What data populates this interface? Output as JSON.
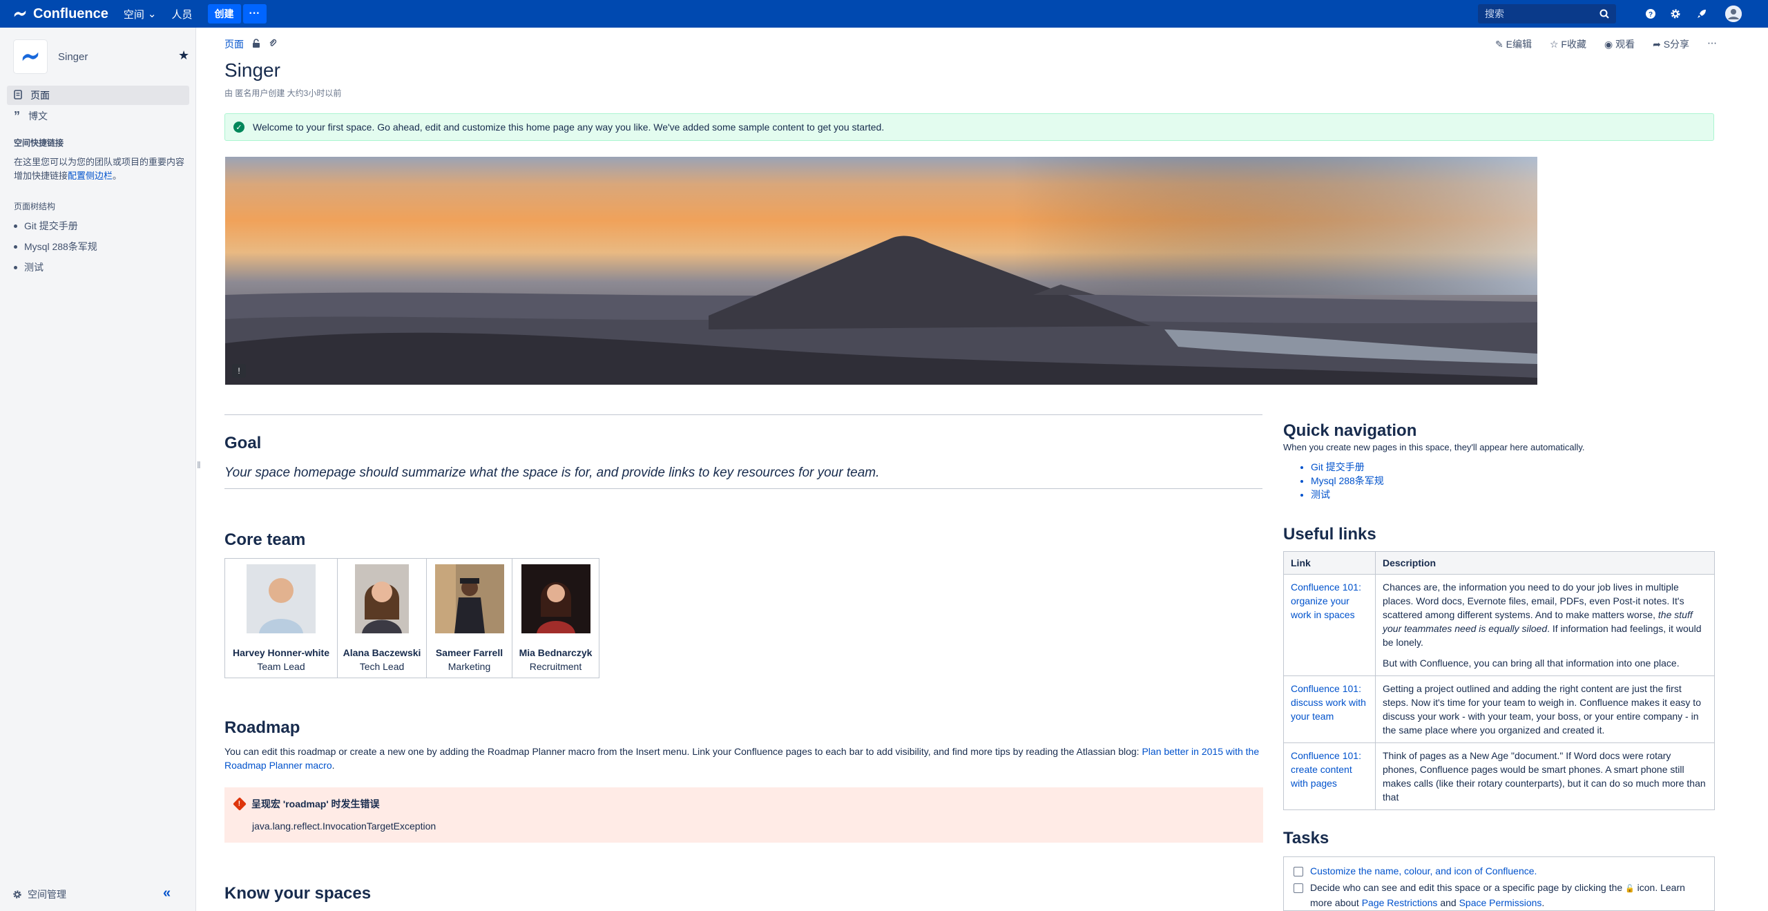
{
  "topbar": {
    "brand": "Confluence",
    "nav_spaces": "空间",
    "nav_people": "人员",
    "create": "创建",
    "more": "···",
    "search_placeholder": "搜索"
  },
  "sidebar": {
    "space_name": "Singer",
    "items": [
      {
        "label": "页面"
      },
      {
        "label": "博文"
      }
    ],
    "shortcuts_heading": "空间快捷链接",
    "shortcuts_text": "在这里您可以为您的团队或项目的重要内容增加快捷链接",
    "shortcuts_link": "配置侧边栏",
    "shortcuts_end": "。",
    "tree_heading": "页面树结构",
    "tree": [
      "Git 提交手册",
      "Mysql 288条军规",
      "测试"
    ],
    "footer": "空间管理"
  },
  "page": {
    "crumb": "页面",
    "actions": {
      "edit": "E编辑",
      "save": "F收藏",
      "watch": "观看",
      "share": "S分享"
    },
    "title": "Singer",
    "byline": "由 匿名用户创建 大约3小时以前",
    "banner": "Welcome to your first space. Go ahead, edit and customize this home page any way you like. We've added some sample content to get you started.",
    "goal_heading": "Goal",
    "goal_text": "Your space homepage should summarize what the space is for, and provide links to key resources for your team.",
    "team_heading": "Core team",
    "team": [
      {
        "name": "Harvey Honner-white",
        "role": "Team Lead"
      },
      {
        "name": "Alana Baczewski",
        "role": "Tech Lead"
      },
      {
        "name": "Sameer Farrell",
        "role": "Marketing"
      },
      {
        "name": "Mia Bednarczyk",
        "role": "Recruitment"
      }
    ],
    "roadmap_heading": "Roadmap",
    "roadmap_text": "You can edit this roadmap or create a new one by adding the Roadmap Planner macro from the Insert menu. Link your Confluence pages to each bar to add visibility, and find more tips by reading the Atlassian blog: ",
    "roadmap_link": "Plan better in 2015 with the Roadmap Planner macro",
    "roadmap_end": ".",
    "error_title": "呈现宏 'roadmap' 时发生错误",
    "error_msg": "java.lang.reflect.InvocationTargetException",
    "spaces_heading": "Know your spaces"
  },
  "right": {
    "qn_heading": "Quick navigation",
    "qn_sub": "When you create new pages in this space, they'll appear here automatically.",
    "qn_links": [
      "Git 提交手册",
      "Mysql 288条军规",
      "测试"
    ],
    "links_heading": "Useful links",
    "table_headers": [
      "Link",
      "Description"
    ],
    "rows": [
      {
        "link": "Confluence 101: organize your work in spaces",
        "desc1": "Chances are, the information you need to do your job lives in multiple places. Word docs, Evernote files, email, PDFs, even Post-it notes. It's scattered among different systems. And to make matters worse, ",
        "desc_em": "the stuff your teammates need is equally siloed",
        "desc2": ". If information had feelings, it would be lonely.",
        "desc3": "But with Confluence, you can bring all that information into one place."
      },
      {
        "link": "Confluence 101: discuss work with your team",
        "desc1": "Getting a project outlined and adding the right content are just the first steps. Now it's time for your team to weigh in. Confluence makes it easy to discuss your work - with your team, your boss, or your entire company - in the same place where you organized and created it."
      },
      {
        "link": "Confluence 101: create content with pages",
        "desc1": "Think of pages as a New Age \"document.\" If Word docs were rotary phones, Confluence pages would be smart phones. A smart phone still makes calls (like their rotary counterparts), but it can do so much more than that"
      }
    ],
    "tasks_heading": "Tasks",
    "task1": "Customize the name, colour, and icon of Confluence.",
    "task2_a": "Decide who can see and edit this space or a specific page by clicking the",
    "task2_b": "icon. Learn more about ",
    "task2_link1": "Page Restrictions",
    "task2_and": " and ",
    "task2_link2": "Space Permissions",
    "task2_end": "."
  }
}
